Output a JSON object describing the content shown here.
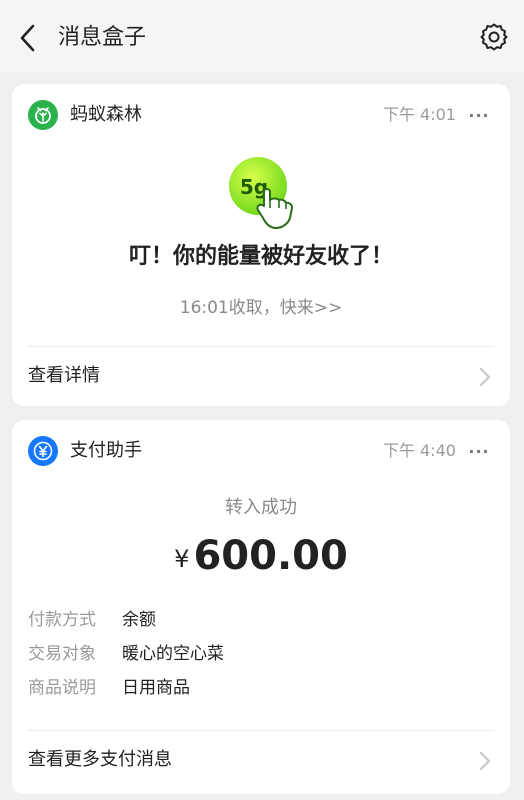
{
  "header": {
    "title": "消息盒子"
  },
  "cards": [
    {
      "app_name": "蚂蚁森林",
      "time": "下午 4:01",
      "more": "···",
      "energy_amount": "5g",
      "heading": "叮！你的能量被好友收了！",
      "subtext": "16:01收取，快来>>",
      "link_label": "查看详情",
      "accent": "#2bb24c"
    },
    {
      "app_name": "支付助手",
      "time": "下午 4:40",
      "more": "···",
      "status": "转入成功",
      "currency": "¥",
      "amount": "600.00",
      "details": [
        {
          "key": "付款方式",
          "value": "余额"
        },
        {
          "key": "交易对象",
          "value": "暖心的空心菜"
        },
        {
          "key": "商品说明",
          "value": "日用商品"
        }
      ],
      "link_label": "查看更多支付消息",
      "accent": "#1677ff"
    }
  ],
  "icons": {
    "back": "chevron-left-icon",
    "settings": "gear-icon",
    "forest": "leaf-icon",
    "pay": "yen-icon",
    "link_chevron": "chevron-right-icon"
  }
}
